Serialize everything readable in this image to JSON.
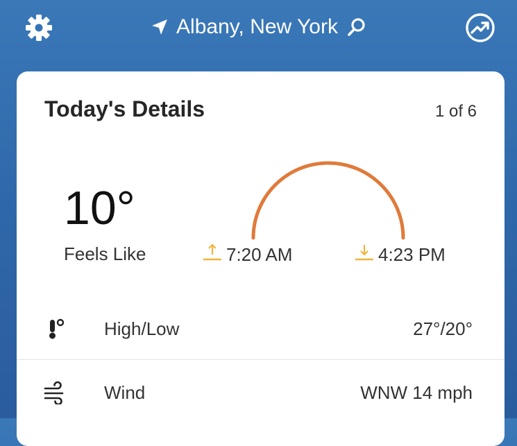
{
  "header": {
    "location": "Albany, New York",
    "icons": [
      "gear-icon",
      "location-arrow-icon",
      "search-icon",
      "trend-icon"
    ]
  },
  "card": {
    "title": "Today's Details",
    "pager": "1 of 6",
    "feels_like_temp": "10°",
    "feels_like_label": "Feels Like",
    "sunrise": "7:20 AM",
    "sunset": "4:23 PM",
    "rows": [
      {
        "icon": "thermometer-icon",
        "label": "High/Low",
        "value": "27°/20°"
      },
      {
        "icon": "wind-icon",
        "label": "Wind",
        "value": "WNW 14 mph"
      }
    ]
  },
  "colors": {
    "background": "#3a78b8",
    "sun_arc": "#e07a3a",
    "sun_icon": "#f0b43a"
  }
}
